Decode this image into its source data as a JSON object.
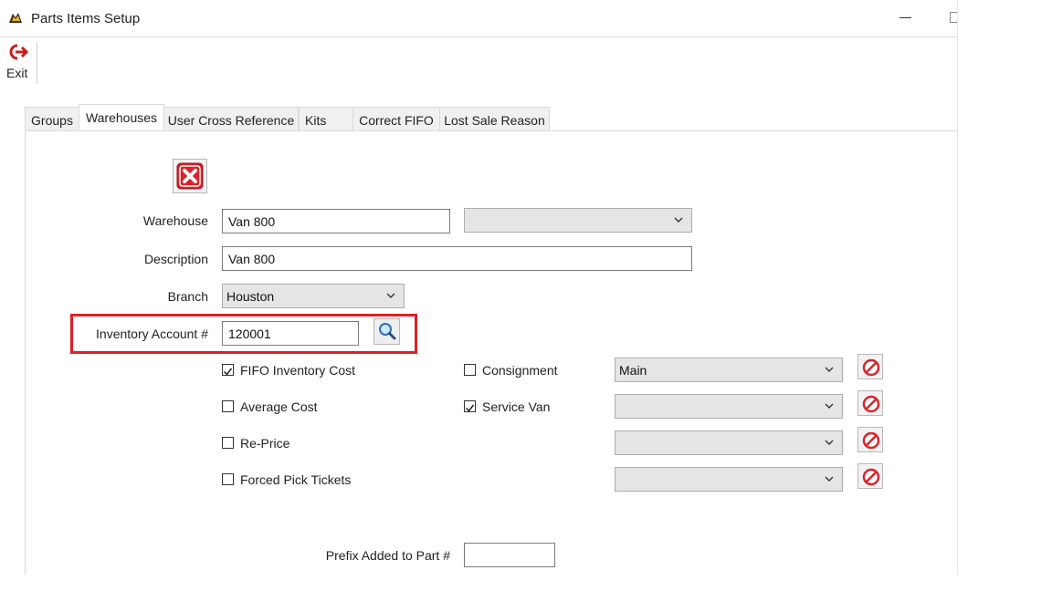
{
  "window": {
    "title": "Parts Items Setup"
  },
  "toolbar": {
    "exit_label": "Exit"
  },
  "tabs": [
    {
      "label": "Groups"
    },
    {
      "label": "Warehouses"
    },
    {
      "label": "User Cross Reference"
    },
    {
      "label": "Kits"
    },
    {
      "label": "Correct FIFO"
    },
    {
      "label": "Lost Sale Reason"
    }
  ],
  "form": {
    "warehouse_label": "Warehouse",
    "warehouse_value": "Van 800",
    "warehouse_select_value": "",
    "description_label": "Description",
    "description_value": "Van 800",
    "branch_label": "Branch",
    "branch_value": "Houston",
    "inventory_account_label": "Inventory Account #",
    "inventory_account_value": "120001",
    "fifo_label": "FIFO Inventory Cost",
    "fifo_checked": true,
    "average_cost_label": "Average Cost",
    "average_cost_checked": false,
    "reprice_label": "Re-Price",
    "reprice_checked": false,
    "forced_pick_label": "Forced Pick Tickets",
    "forced_pick_checked": false,
    "consignment_label": "Consignment",
    "consignment_checked": false,
    "service_van_label": "Service Van",
    "service_van_checked": true,
    "select1_value": "Main",
    "select2_value": "",
    "select3_value": "",
    "select4_value": "",
    "prefix_label": "Prefix Added to Part #",
    "prefix_value": ""
  },
  "colors": {
    "highlight": "#e01f26",
    "exit_icon": "#c81e1e",
    "delete_icon": "#d9242b"
  }
}
